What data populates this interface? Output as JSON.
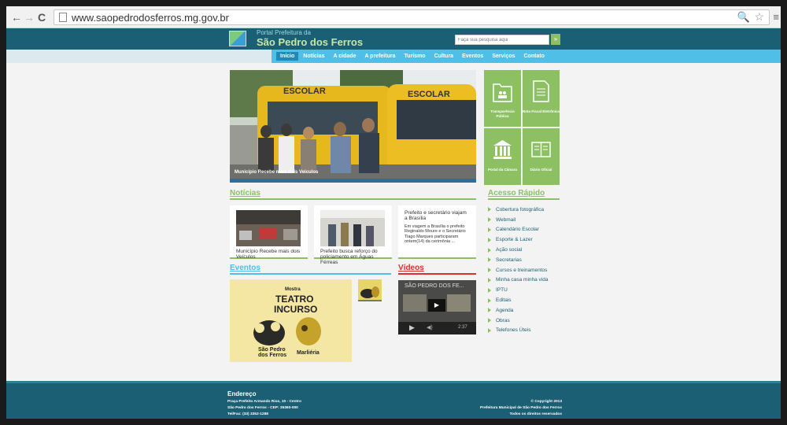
{
  "browser": {
    "url": "www.saopedrodosferros.mg.gov.br",
    "back": "←",
    "forward": "→",
    "reload": "C",
    "zoom": "🔍",
    "star": "☆",
    "menu": "≡"
  },
  "header": {
    "kicker": "Portal Prefeitura da",
    "site_name": "São Pedro dos Ferros",
    "search_placeholder": "Faça sua pesquisa aqui",
    "search_button": "»"
  },
  "nav": {
    "items": [
      "Início",
      "Notícias",
      "A cidade",
      "A prefeitura",
      "Turismo",
      "Cultura",
      "Eventos",
      "Serviços",
      "Contato"
    ]
  },
  "hero": {
    "caption": "Município Recebe mais dois Veículos",
    "bus_left_text": "ESCOLAR",
    "bus_right_text": "ESCOLAR"
  },
  "tiles": [
    {
      "label": "Transparência Pública"
    },
    {
      "label": "Nota Fiscal Eletrônica"
    },
    {
      "label": "Portal da Câmara"
    },
    {
      "label": "Diário Oficial"
    }
  ],
  "news": {
    "title": "Notícias",
    "cards": [
      {
        "title": "Município Recebe mais dois Veículos"
      },
      {
        "title": "Prefeito busca reforço do policiamento em Águas Férreas"
      },
      {
        "title": "Prefeito e secretário viajam a Brasília",
        "body": "Em viagem a Brasília o prefeito Reginaldo Moure e o Secretário Tiago Marques participaram ontem(14) da cerimônia ..."
      }
    ]
  },
  "events": {
    "title": "Eventos",
    "poster_lines": [
      "Mostra",
      "TEATRO",
      "INCURSO",
      "São Pedro dos Ferros",
      "Marliéria"
    ]
  },
  "videos": {
    "title": "Vídeos",
    "video_title": "SÃO PEDRO DOS FE...",
    "time": "2:37"
  },
  "quick_access": {
    "title": "Acesso Rápido",
    "items": [
      "Cobertura fotográfica",
      "Webmail",
      "Calendário Escolar",
      "Esporte & Lazer",
      "Ação social",
      "Secretarias",
      "Cursos e treinamentos",
      "Minha casa minha vida",
      "IPTU",
      "Editais",
      "Agenda",
      "Obras",
      "Telefones Úteis"
    ]
  },
  "footer": {
    "title": "Endereço",
    "address_1": "Praça Prefeito Armando Rios, 10 - Centro",
    "address_2": "São Pedro dos Ferros - CEP: 35360-000",
    "phone": "Tel/Fax: (33) 3352-1288",
    "copyright": "© Copyright 2013",
    "org": "Prefeitura Municipal de São Pedro dos Ferros",
    "rights": "Todos os direitos reservados"
  },
  "colors": {
    "header_bg": "#1a5f74",
    "nav_bg": "#4fbfe8",
    "accent_green": "#8cc063",
    "video_red": "#d9312b"
  }
}
